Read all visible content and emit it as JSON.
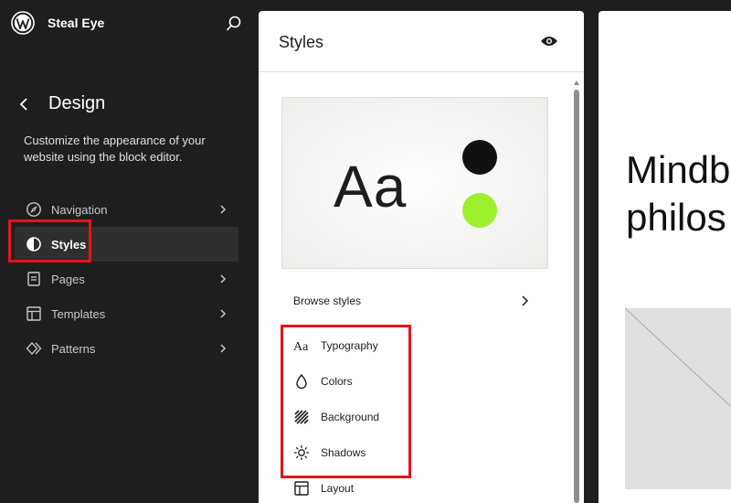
{
  "site": {
    "name": "Steal Eye"
  },
  "sidebar": {
    "title": "Design",
    "description": "Customize the appearance of your website using the block editor.",
    "items": [
      {
        "label": "Navigation",
        "icon": "compass-icon",
        "active": false,
        "has_chevron": true
      },
      {
        "label": "Styles",
        "icon": "half-circle-icon",
        "active": true,
        "has_chevron": false
      },
      {
        "label": "Pages",
        "icon": "page-icon",
        "active": false,
        "has_chevron": true
      },
      {
        "label": "Templates",
        "icon": "layout-icon",
        "active": false,
        "has_chevron": true
      },
      {
        "label": "Patterns",
        "icon": "diamond-icon",
        "active": false,
        "has_chevron": true
      }
    ]
  },
  "styles_panel": {
    "title": "Styles",
    "preview": {
      "sample_text": "Aa",
      "color_dark": "#111111",
      "color_accent": "#9cf02d"
    },
    "browse_label": "Browse styles",
    "items": [
      {
        "label": "Typography",
        "icon": "typography-icon"
      },
      {
        "label": "Colors",
        "icon": "droplet-icon"
      },
      {
        "label": "Background",
        "icon": "background-icon"
      },
      {
        "label": "Shadows",
        "icon": "shadow-sun-icon"
      },
      {
        "label": "Layout",
        "icon": "layout-icon"
      }
    ]
  },
  "canvas": {
    "heading": "Mindb\nphilos"
  },
  "colors": {
    "highlight": "#e8141b",
    "sidebar_bg": "#1e1e1e"
  }
}
